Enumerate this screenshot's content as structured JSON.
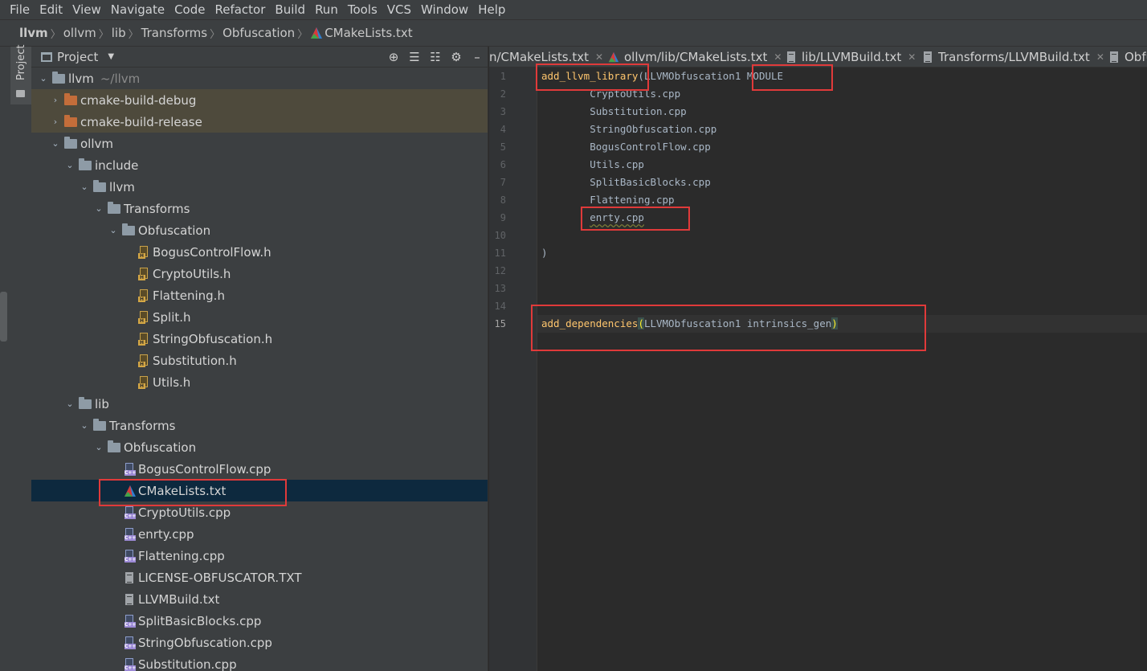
{
  "menu": [
    "File",
    "Edit",
    "View",
    "Navigate",
    "Code",
    "Refactor",
    "Build",
    "Run",
    "Tools",
    "VCS",
    "Window",
    "Help"
  ],
  "breadcrumb": [
    "llvm",
    "ollvm",
    "lib",
    "Transforms",
    "Obfuscation",
    "CMakeLists.txt"
  ],
  "tool_window": {
    "label": "Project"
  },
  "project_panel": {
    "title": "Project",
    "tree": [
      {
        "label": "llvm",
        "extra": "~/llvm"
      },
      {
        "label": "cmake-build-debug"
      },
      {
        "label": "cmake-build-release"
      },
      {
        "label": "ollvm"
      },
      {
        "label": "include"
      },
      {
        "label": "llvm"
      },
      {
        "label": "Transforms"
      },
      {
        "label": "Obfuscation"
      },
      {
        "label": "BogusControlFlow.h"
      },
      {
        "label": "CryptoUtils.h"
      },
      {
        "label": "Flattening.h"
      },
      {
        "label": "Split.h"
      },
      {
        "label": "StringObfuscation.h"
      },
      {
        "label": "Substitution.h"
      },
      {
        "label": "Utils.h"
      },
      {
        "label": "lib"
      },
      {
        "label": "Transforms"
      },
      {
        "label": "Obfuscation"
      },
      {
        "label": "BogusControlFlow.cpp"
      },
      {
        "label": "CMakeLists.txt"
      },
      {
        "label": "CryptoUtils.cpp"
      },
      {
        "label": "enrty.cpp"
      },
      {
        "label": "Flattening.cpp"
      },
      {
        "label": "LICENSE-OBFUSCATOR.TXT"
      },
      {
        "label": "LLVMBuild.txt"
      },
      {
        "label": "SplitBasicBlocks.cpp"
      },
      {
        "label": "StringObfuscation.cpp"
      },
      {
        "label": "Substitution.cpp"
      }
    ]
  },
  "tabs": [
    "n/CMakeLists.txt",
    "ollvm/lib/CMakeLists.txt",
    "lib/LLVMBuild.txt",
    "Transforms/LLVMBuild.txt",
    "Obfu"
  ],
  "editor": {
    "line_numbers": [
      "1",
      "2",
      "3",
      "4",
      "5",
      "6",
      "7",
      "8",
      "9",
      "10",
      "11",
      "12",
      "13",
      "14",
      "15"
    ],
    "line1": {
      "fn": "add_llvm_library",
      "open": "(",
      "rest": "LLVMObfuscation1 MODULE"
    },
    "sources": [
      "CryptoUtils.cpp",
      "Substitution.cpp",
      "StringObfuscation.cpp",
      "BogusControlFlow.cpp",
      "Utils.cpp",
      "SplitBasicBlocks.cpp",
      "Flattening.cpp",
      "enrty.cpp"
    ],
    "line11": ")",
    "line15": {
      "fn": "add_dependencies",
      "open": "(",
      "rest": "LLVMObfuscation1 intrinsics_gen",
      "close": ")"
    }
  }
}
